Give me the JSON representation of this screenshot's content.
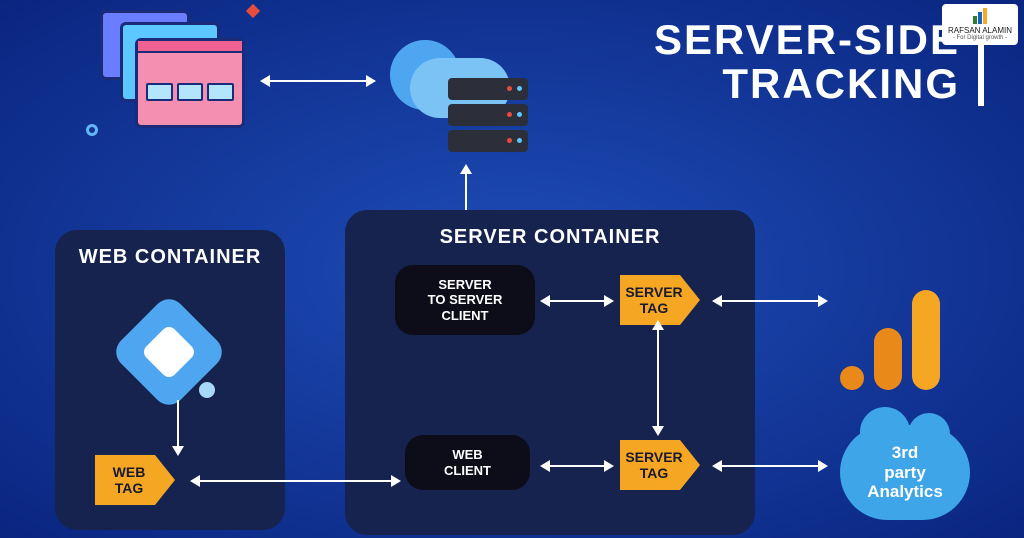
{
  "title_line1": "SERVER-SIDE",
  "title_line2": "TRACKING",
  "logo": {
    "name": "RAFSAN ALAMIN",
    "tagline": "- For Digital growth -"
  },
  "web_container": {
    "title": "WEB CONTAINER",
    "web_tag": "WEB\nTAG"
  },
  "server_container": {
    "title": "SERVER CONTAINER",
    "s2s_client": "SERVER\nTO SERVER\nCLIENT",
    "web_client": "WEB\nCLIENT",
    "server_tag_1": "SERVER\nTAG",
    "server_tag_2": "SERVER\nTAG"
  },
  "third_party": "3rd\nparty\nAnalytics",
  "colors": {
    "accent_orange": "#f5a623",
    "node_black": "#0d0d1a",
    "container_navy": "#16234f",
    "cloud_blue": "#3ea5e8"
  }
}
